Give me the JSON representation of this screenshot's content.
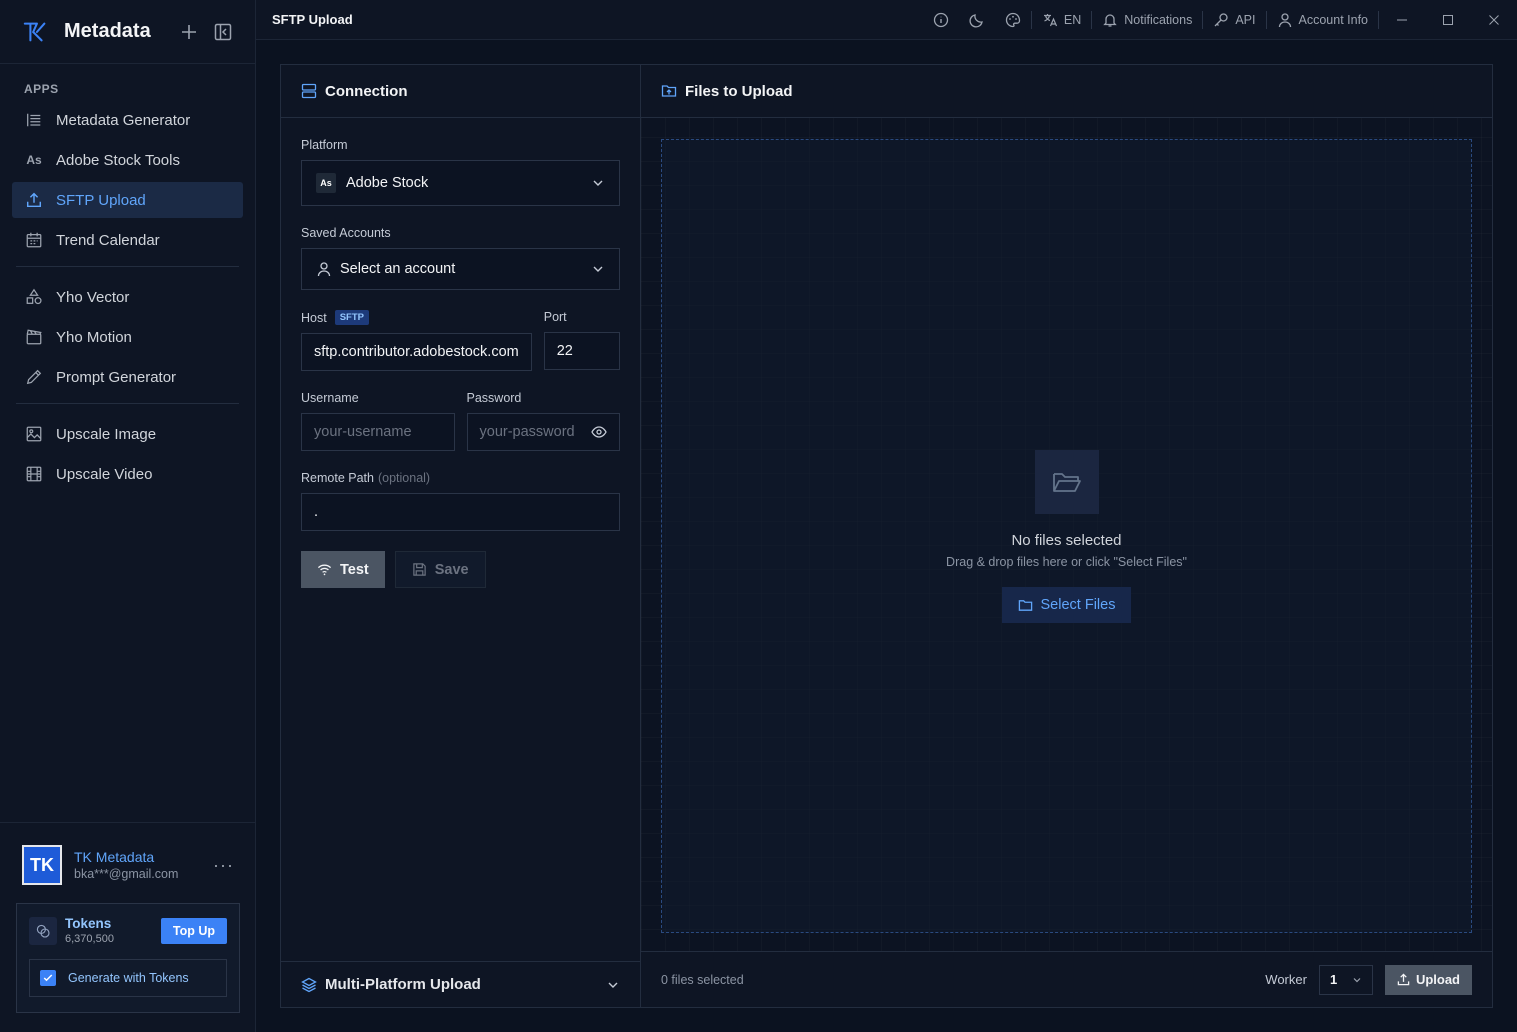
{
  "app": {
    "name": "Metadata"
  },
  "sidebar": {
    "section": "APPS",
    "items": [
      {
        "label": "Metadata Generator",
        "icon": "list-icon"
      },
      {
        "label": "Adobe Stock Tools",
        "icon": "as-icon",
        "glyph": "As"
      },
      {
        "label": "SFTP Upload",
        "icon": "upload-icon",
        "active": true
      },
      {
        "label": "Trend Calendar",
        "icon": "calendar-icon"
      },
      {
        "label": "Yho Vector",
        "icon": "shapes-icon"
      },
      {
        "label": "Yho Motion",
        "icon": "clapper-icon"
      },
      {
        "label": "Prompt Generator",
        "icon": "pencil-icon"
      },
      {
        "label": "Upscale Image",
        "icon": "image-icon"
      },
      {
        "label": "Upscale Video",
        "icon": "film-icon"
      }
    ],
    "user": {
      "initials": "TK",
      "name": "TK Metadata",
      "email": "bka***@gmail.com",
      "menu": "···"
    },
    "tokens": {
      "title": "Tokens",
      "count": "6,370,500",
      "topup": "Top Up",
      "generate": "Generate with Tokens",
      "generate_checked": true
    }
  },
  "topbar": {
    "title": "SFTP Upload",
    "lang": "EN",
    "notifications": "Notifications",
    "api": "API",
    "account": "Account Info"
  },
  "connection": {
    "title": "Connection",
    "platform_label": "Platform",
    "platform_glyph": "As",
    "platform_value": "Adobe Stock",
    "accounts_label": "Saved Accounts",
    "accounts_value": "Select an account",
    "host_label": "Host",
    "host_badge": "SFTP",
    "host_value": "sftp.contributor.adobestock.com",
    "port_label": "Port",
    "port_value": "22",
    "username_label": "Username",
    "username_placeholder": "your-username",
    "password_label": "Password",
    "password_placeholder": "your-password",
    "remote_label": "Remote Path",
    "remote_optional": "(optional)",
    "remote_value": ".",
    "test": "Test",
    "save": "Save",
    "multi": "Multi-Platform Upload"
  },
  "files": {
    "title": "Files to Upload",
    "empty_title": "No files selected",
    "empty_sub": "Drag & drop files here or click \"Select Files\"",
    "select_button": "Select Files",
    "status": "0 files selected",
    "worker_label": "Worker",
    "worker_value": "1",
    "upload": "Upload"
  },
  "colors": {
    "accent": "#3b82f6",
    "bg": "#0b1220",
    "panel": "#0e1524"
  }
}
